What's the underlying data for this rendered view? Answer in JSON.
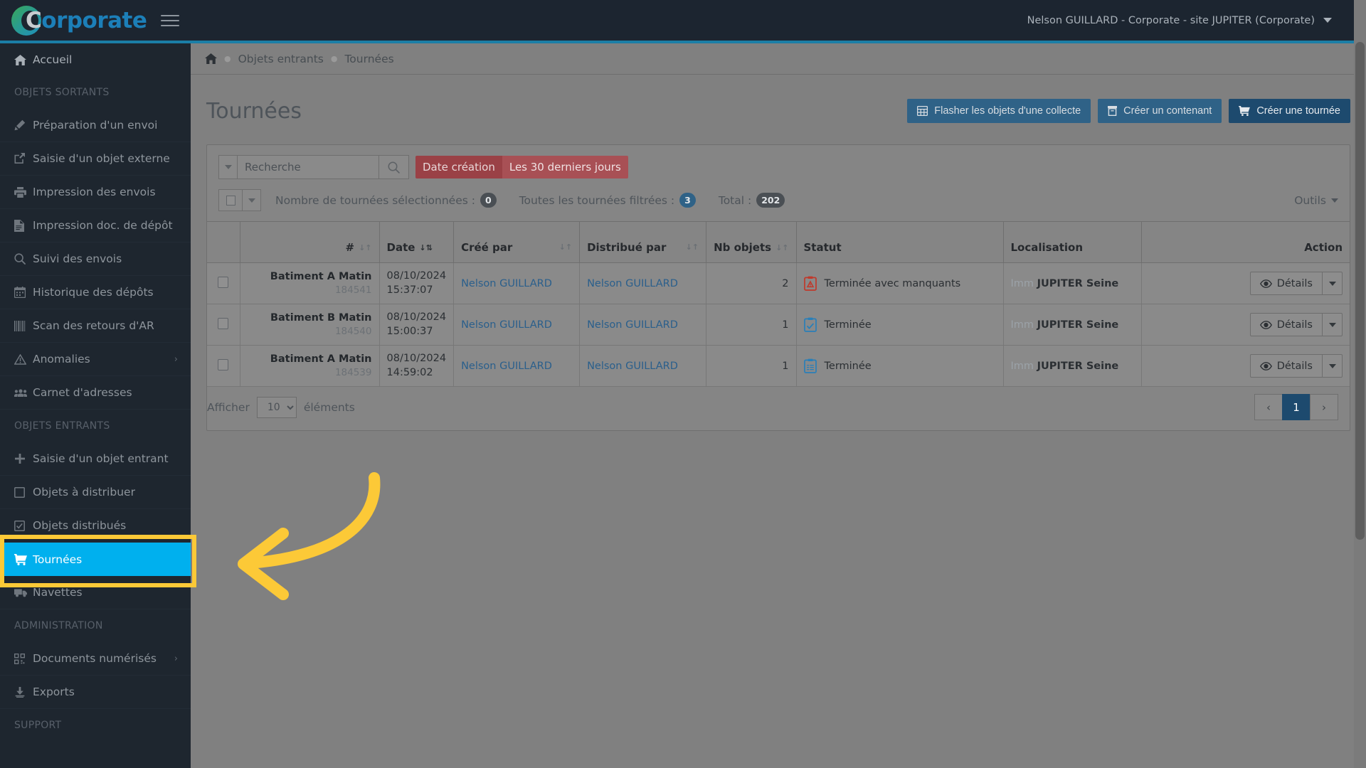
{
  "app": {
    "brand_cap": "C",
    "brand_rest": "orporate",
    "user_menu": "Nelson GUILLARD - Corporate - site JUPITER (Corporate)"
  },
  "breadcrumb": {
    "home_icon": "home-icon",
    "items": [
      "Objets entrants",
      "Tournées"
    ]
  },
  "sidebar": {
    "home": {
      "label": "Accueil",
      "icon": "home-icon"
    },
    "groups": [
      {
        "heading": "OBJETS SORTANTS",
        "items": [
          {
            "label": "Préparation d'un envoi",
            "icon": "pencil-icon"
          },
          {
            "label": "Saisie d'un objet externe",
            "icon": "external-link-icon"
          },
          {
            "label": "Impression des envois",
            "icon": "printer-icon"
          },
          {
            "label": "Impression doc. de dépôt",
            "icon": "document-icon"
          },
          {
            "label": "Suivi des envois",
            "icon": "search-icon"
          },
          {
            "label": "Historique des dépôts",
            "icon": "calendar-icon"
          },
          {
            "label": "Scan des retours d'AR",
            "icon": "barcode-icon"
          },
          {
            "label": "Anomalies",
            "icon": "warning-triangle-icon",
            "chevron": "›"
          },
          {
            "label": "Carnet d'adresses",
            "icon": "users-icon"
          }
        ]
      },
      {
        "heading": "OBJETS ENTRANTS",
        "items": [
          {
            "label": "Saisie d'un objet entrant",
            "icon": "plus-icon"
          },
          {
            "label": "Objets à distribuer",
            "icon": "square-icon"
          },
          {
            "label": "Objets distribués",
            "icon": "check-square-icon"
          },
          {
            "label": "Tournées",
            "icon": "cart-icon",
            "active": true
          },
          {
            "label": "Navettes",
            "icon": "truck-icon"
          }
        ]
      },
      {
        "heading": "ADMINISTRATION",
        "items": [
          {
            "label": "Documents numérisés",
            "icon": "qr-icon",
            "chevron": "›"
          },
          {
            "label": "Exports",
            "icon": "download-icon"
          }
        ]
      },
      {
        "heading": "SUPPORT",
        "items": []
      }
    ]
  },
  "page": {
    "title": "Tournées",
    "buttons": [
      {
        "label": "Flasher les objets d'une collecte",
        "icon": "grid-icon",
        "style": "mid"
      },
      {
        "label": "Créer un contenant",
        "icon": "box-icon",
        "style": "mid"
      },
      {
        "label": "Créer une tournée",
        "icon": "cart-icon",
        "style": "dark"
      }
    ]
  },
  "filters": {
    "search_placeholder": "Recherche",
    "search_value": "",
    "search_icon": "search-icon",
    "dropdown_icon": "caret-down-icon",
    "date_filter_label": "Date création",
    "date_filter_value": "Les 30 derniers jours"
  },
  "counters": {
    "selected_label": "Nombre de tournées sélectionnées :",
    "selected_value": "0",
    "filtered_label": "Toutes les tournées filtrées :",
    "filtered_value": "3",
    "total_label": "Total :",
    "total_value": "202",
    "tools_label": "Outils"
  },
  "table": {
    "columns": [
      {
        "key": "select",
        "label": "",
        "sort": ""
      },
      {
        "key": "name",
        "label": "#",
        "sort": "↓↑"
      },
      {
        "key": "date",
        "label": "Date",
        "sort": "↓⇅"
      },
      {
        "key": "creator",
        "label": "Créé par",
        "sort": "↓↑"
      },
      {
        "key": "distributor",
        "label": "Distribué par",
        "sort": "↓↑"
      },
      {
        "key": "nb",
        "label": "Nb objets",
        "sort": "↓↑"
      },
      {
        "key": "status",
        "label": "Statut",
        "sort": ""
      },
      {
        "key": "location",
        "label": "Localisation",
        "sort": ""
      },
      {
        "key": "action",
        "label": "Action",
        "sort": ""
      }
    ],
    "rows": [
      {
        "name": "Batiment A Matin",
        "id": "184541",
        "date_day": "08/10/2024",
        "date_time": "15:37:07",
        "creator": "Nelson GUILLARD",
        "distributor": "Nelson GUILLARD",
        "nb": "2",
        "status": "Terminée avec manquants",
        "status_icon": "clipboard-alert-icon",
        "status_color": "#c0392b",
        "loc_prefix": "Imm",
        "loc_name": "JUPITER Seine",
        "action_label": "Détails",
        "action_icon": "eye-icon"
      },
      {
        "name": "Batiment B Matin",
        "id": "184540",
        "date_day": "08/10/2024",
        "date_time": "15:00:37",
        "creator": "Nelson GUILLARD",
        "distributor": "Nelson GUILLARD",
        "nb": "1",
        "status": "Terminée",
        "status_icon": "clipboard-check-icon",
        "status_color": "#2a7fb8",
        "loc_prefix": "Imm",
        "loc_name": "JUPITER Seine",
        "action_label": "Détails",
        "action_icon": "eye-icon"
      },
      {
        "name": "Batiment A Matin",
        "id": "184539",
        "date_day": "08/10/2024",
        "date_time": "14:59:02",
        "creator": "Nelson GUILLARD",
        "distributor": "Nelson GUILLARD",
        "nb": "1",
        "status": "Terminée",
        "status_icon": "clipboard-list-icon",
        "status_color": "#2a7fb8",
        "loc_prefix": "Imm",
        "loc_name": "JUPITER Seine",
        "action_label": "Détails",
        "action_icon": "eye-icon"
      }
    ]
  },
  "footer": {
    "show_label": "Afficher",
    "page_size": "10",
    "items_label": "éléments",
    "prev": "‹",
    "page": "1",
    "next": "›"
  },
  "annotation": {
    "highlight_target": "Tournées",
    "arrow_color": "#fcc937",
    "box_color": "#fcc937"
  },
  "colors": {
    "accent_blue": "#00b0ee",
    "header_dark": "#1c2530",
    "sidebar": "#1e262f",
    "brand_blue": "#1c7fb8",
    "btn_primary": "#2f6287",
    "btn_dark": "#1d4a6e",
    "date_filter_red": "#a85055"
  }
}
